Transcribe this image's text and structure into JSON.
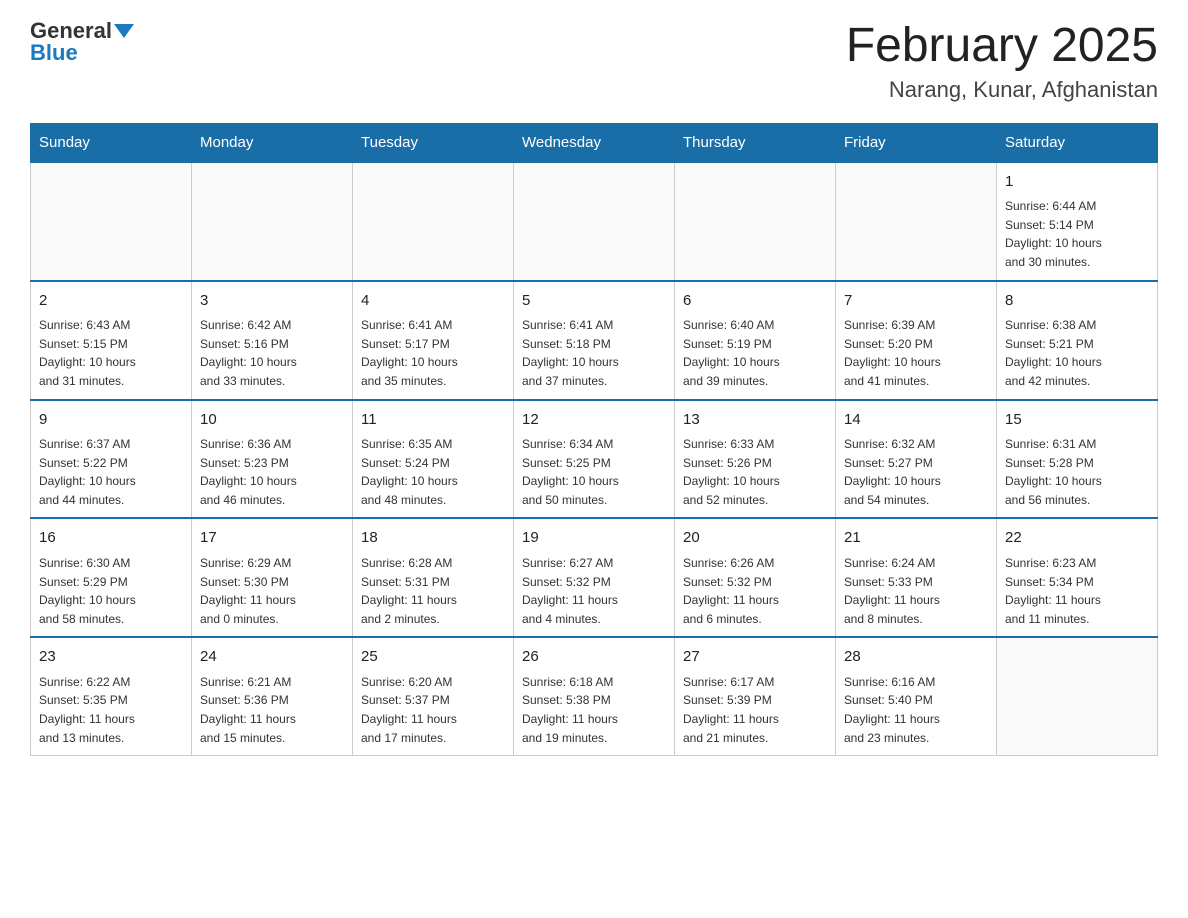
{
  "header": {
    "logo_general": "General",
    "logo_blue": "Blue",
    "month_title": "February 2025",
    "location": "Narang, Kunar, Afghanistan"
  },
  "weekdays": [
    "Sunday",
    "Monday",
    "Tuesday",
    "Wednesday",
    "Thursday",
    "Friday",
    "Saturday"
  ],
  "weeks": [
    [
      {
        "day": "",
        "info": ""
      },
      {
        "day": "",
        "info": ""
      },
      {
        "day": "",
        "info": ""
      },
      {
        "day": "",
        "info": ""
      },
      {
        "day": "",
        "info": ""
      },
      {
        "day": "",
        "info": ""
      },
      {
        "day": "1",
        "info": "Sunrise: 6:44 AM\nSunset: 5:14 PM\nDaylight: 10 hours\nand 30 minutes."
      }
    ],
    [
      {
        "day": "2",
        "info": "Sunrise: 6:43 AM\nSunset: 5:15 PM\nDaylight: 10 hours\nand 31 minutes."
      },
      {
        "day": "3",
        "info": "Sunrise: 6:42 AM\nSunset: 5:16 PM\nDaylight: 10 hours\nand 33 minutes."
      },
      {
        "day": "4",
        "info": "Sunrise: 6:41 AM\nSunset: 5:17 PM\nDaylight: 10 hours\nand 35 minutes."
      },
      {
        "day": "5",
        "info": "Sunrise: 6:41 AM\nSunset: 5:18 PM\nDaylight: 10 hours\nand 37 minutes."
      },
      {
        "day": "6",
        "info": "Sunrise: 6:40 AM\nSunset: 5:19 PM\nDaylight: 10 hours\nand 39 minutes."
      },
      {
        "day": "7",
        "info": "Sunrise: 6:39 AM\nSunset: 5:20 PM\nDaylight: 10 hours\nand 41 minutes."
      },
      {
        "day": "8",
        "info": "Sunrise: 6:38 AM\nSunset: 5:21 PM\nDaylight: 10 hours\nand 42 minutes."
      }
    ],
    [
      {
        "day": "9",
        "info": "Sunrise: 6:37 AM\nSunset: 5:22 PM\nDaylight: 10 hours\nand 44 minutes."
      },
      {
        "day": "10",
        "info": "Sunrise: 6:36 AM\nSunset: 5:23 PM\nDaylight: 10 hours\nand 46 minutes."
      },
      {
        "day": "11",
        "info": "Sunrise: 6:35 AM\nSunset: 5:24 PM\nDaylight: 10 hours\nand 48 minutes."
      },
      {
        "day": "12",
        "info": "Sunrise: 6:34 AM\nSunset: 5:25 PM\nDaylight: 10 hours\nand 50 minutes."
      },
      {
        "day": "13",
        "info": "Sunrise: 6:33 AM\nSunset: 5:26 PM\nDaylight: 10 hours\nand 52 minutes."
      },
      {
        "day": "14",
        "info": "Sunrise: 6:32 AM\nSunset: 5:27 PM\nDaylight: 10 hours\nand 54 minutes."
      },
      {
        "day": "15",
        "info": "Sunrise: 6:31 AM\nSunset: 5:28 PM\nDaylight: 10 hours\nand 56 minutes."
      }
    ],
    [
      {
        "day": "16",
        "info": "Sunrise: 6:30 AM\nSunset: 5:29 PM\nDaylight: 10 hours\nand 58 minutes."
      },
      {
        "day": "17",
        "info": "Sunrise: 6:29 AM\nSunset: 5:30 PM\nDaylight: 11 hours\nand 0 minutes."
      },
      {
        "day": "18",
        "info": "Sunrise: 6:28 AM\nSunset: 5:31 PM\nDaylight: 11 hours\nand 2 minutes."
      },
      {
        "day": "19",
        "info": "Sunrise: 6:27 AM\nSunset: 5:32 PM\nDaylight: 11 hours\nand 4 minutes."
      },
      {
        "day": "20",
        "info": "Sunrise: 6:26 AM\nSunset: 5:32 PM\nDaylight: 11 hours\nand 6 minutes."
      },
      {
        "day": "21",
        "info": "Sunrise: 6:24 AM\nSunset: 5:33 PM\nDaylight: 11 hours\nand 8 minutes."
      },
      {
        "day": "22",
        "info": "Sunrise: 6:23 AM\nSunset: 5:34 PM\nDaylight: 11 hours\nand 11 minutes."
      }
    ],
    [
      {
        "day": "23",
        "info": "Sunrise: 6:22 AM\nSunset: 5:35 PM\nDaylight: 11 hours\nand 13 minutes."
      },
      {
        "day": "24",
        "info": "Sunrise: 6:21 AM\nSunset: 5:36 PM\nDaylight: 11 hours\nand 15 minutes."
      },
      {
        "day": "25",
        "info": "Sunrise: 6:20 AM\nSunset: 5:37 PM\nDaylight: 11 hours\nand 17 minutes."
      },
      {
        "day": "26",
        "info": "Sunrise: 6:18 AM\nSunset: 5:38 PM\nDaylight: 11 hours\nand 19 minutes."
      },
      {
        "day": "27",
        "info": "Sunrise: 6:17 AM\nSunset: 5:39 PM\nDaylight: 11 hours\nand 21 minutes."
      },
      {
        "day": "28",
        "info": "Sunrise: 6:16 AM\nSunset: 5:40 PM\nDaylight: 11 hours\nand 23 minutes."
      },
      {
        "day": "",
        "info": ""
      }
    ]
  ]
}
